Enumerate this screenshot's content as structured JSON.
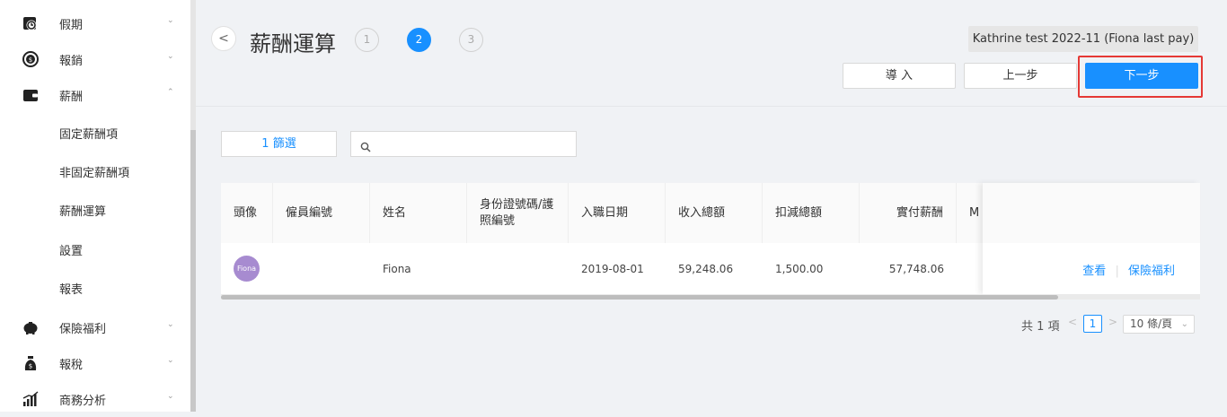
{
  "sidebar": {
    "items": [
      {
        "label": "假期",
        "icon": "clock-calendar-icon",
        "chevron": "⌄"
      },
      {
        "label": "報銷",
        "icon": "money-cycle-icon",
        "chevron": "⌄"
      },
      {
        "label": "薪酬",
        "icon": "wallet-icon",
        "chevron": "⌃"
      },
      {
        "label": "保險福利",
        "icon": "piggy-bank-icon",
        "chevron": "⌄"
      },
      {
        "label": "報稅",
        "icon": "money-bag-icon",
        "chevron": "⌄"
      },
      {
        "label": "商務分析",
        "icon": "bar-chart-icon",
        "chevron": "⌄"
      }
    ],
    "sub_items": [
      "固定薪酬項",
      "非固定薪酬項",
      "薪酬運算",
      "設置",
      "報表"
    ]
  },
  "header": {
    "back": "<",
    "title": "薪酬運算",
    "steps": [
      "1",
      "2",
      "3"
    ],
    "active_step": 2,
    "payroll_name": "Kathrine test 2022-11 (Fiona last pay)",
    "import_label": "導 入",
    "prev_label": "上一步",
    "next_label": "下一步"
  },
  "filter": {
    "label": "1  篩選",
    "search_placeholder": ""
  },
  "table": {
    "columns": [
      "頭像",
      "僱員編號",
      "姓名",
      "身份證號碼/護照編號",
      "入職日期",
      "收入總額",
      "扣減總額",
      "實付薪酬",
      "M"
    ],
    "rows": [
      {
        "avatar": "Fiona",
        "employee_no": "",
        "name": "Fiona",
        "id_no": "",
        "join_date": "2019-08-01",
        "gross": "59,248.06",
        "deduction": "1,500.00",
        "net": "57,748.06",
        "actions": [
          "查看",
          "保險福利"
        ]
      }
    ]
  },
  "pagination": {
    "total": "共 1 項",
    "prev": "<",
    "current": "1",
    "next": ">",
    "page_size": "10 條/頁"
  },
  "colors": {
    "primary": "#1890ff",
    "highlight": "#e53935",
    "avatar": "#a78bd0"
  }
}
